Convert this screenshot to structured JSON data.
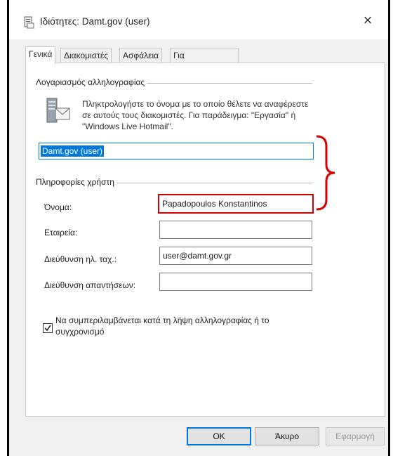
{
  "window": {
    "title": "Ιδιότητες: Damt.gov (user)",
    "close_glyph": "×"
  },
  "tabs": [
    {
      "label": "Γενικά",
      "active": true
    },
    {
      "label": "Διακομιστές",
      "active": false
    },
    {
      "label": "Ασφάλεια",
      "active": false
    },
    {
      "label": "Για προχωρημένους",
      "active": false
    }
  ],
  "mail_account": {
    "group_label": "Λογαριασμός αλληλογραφίας",
    "description": "Πληκτρολογήστε το όνομα με το οποίο θέλετε να αναφέρεστε σε αυτούς τους διακομιστές. Για παράδειγμα: \"Εργασία\" ή \"Windows Live Hotmail\".",
    "account_name": "Damt.gov (user)"
  },
  "user_info": {
    "group_label": "Πληροφορίες χρήστη",
    "fields": [
      {
        "label": "Όνομα:",
        "value": ""
      },
      {
        "label": "Εταιρεία:",
        "value": ""
      },
      {
        "label": "Διεύθυνση ηλ. ταχ.:",
        "value": "user@damt.gov.gr"
      },
      {
        "label": "Διεύθυνση απαντήσεων:",
        "value": ""
      }
    ],
    "name_value": "Papadopoulos Konstantinos"
  },
  "sync_checkbox": {
    "label": "Να συμπεριλαμβάνεται κατά τη λήψη αλληλογραφίας ή το συγχρονισμό",
    "checked": true
  },
  "buttons": {
    "ok": "OK",
    "cancel": "Άκυρο",
    "apply": "Εφαρμογή"
  },
  "colors": {
    "accent": "#0078d7",
    "highlight_red": "#d40000",
    "window_bg": "#f0f0f0"
  },
  "icons": [
    "properties-app-icon",
    "mail-account-icon",
    "close-icon",
    "checkmark-icon"
  ]
}
